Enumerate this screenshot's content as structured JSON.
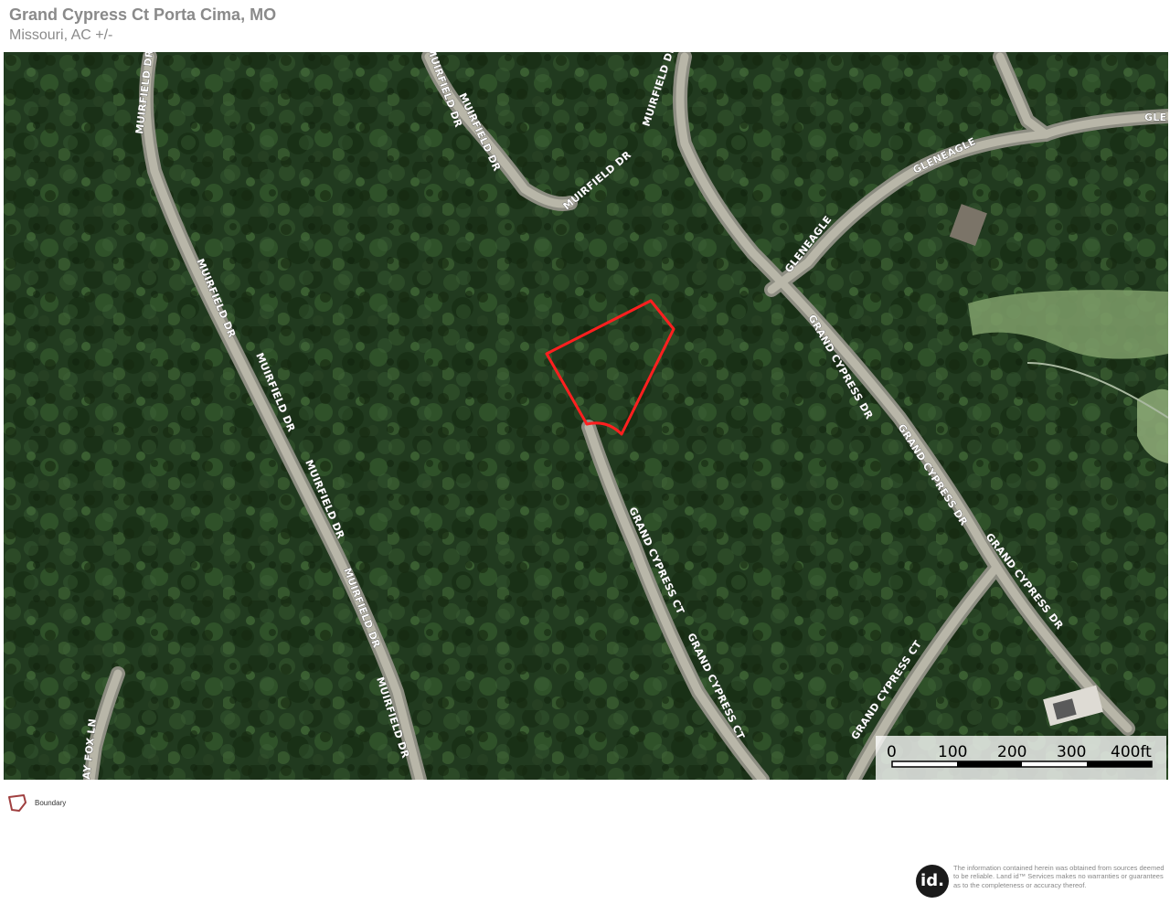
{
  "header": {
    "title": "Grand Cypress Ct Porta Cima, MO",
    "subtitle": "Missouri,  AC +/-"
  },
  "map": {
    "road_labels": [
      "MUIRFIELD DR",
      "MUIRFIELD DR",
      "MUIRFIELD DR",
      "MUIRFIELD DR",
      "MUIRFIELD DR",
      "MUIRFIELD DR",
      "MUIRFIELD DR",
      "MUIRFIELD DR",
      "MUIRFIELD DR",
      "MUIRFIELD DR",
      "GLENEAGLE",
      "GLENEAGLE",
      "GLE",
      "GRAND CYPRESS DR",
      "GRAND CYPRESS DR",
      "GRAND CYPRESS DR",
      "GRAND CYPRESS CT",
      "GRAND CYPRESS CT",
      "GRAND CYPRESS CT",
      "AY FOX LN"
    ],
    "boundary_color": "#ff1f1f",
    "scale": {
      "labels": [
        "0",
        "100",
        "200",
        "300",
        "400ft"
      ]
    }
  },
  "legend": {
    "label": "Boundary",
    "icon": "boundary-polygon-icon",
    "color": "#a04040"
  },
  "footer": {
    "logo_text": "id.",
    "disclaimer": "The information contained herein was obtained from sources deemed to be reliable. Land id™ Services makes no warranties or guarantees as to the completeness or accuracy thereof."
  }
}
